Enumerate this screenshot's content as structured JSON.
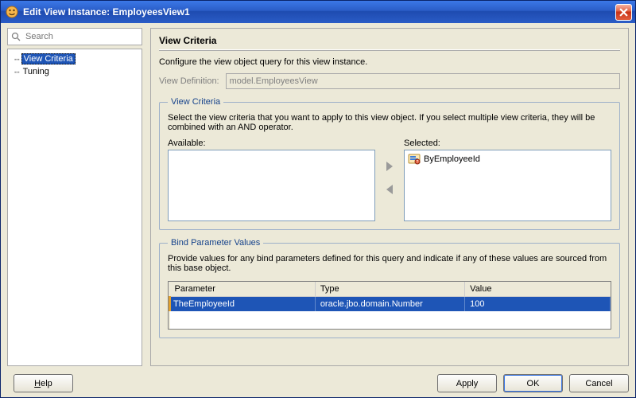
{
  "window": {
    "title_prefix": "Edit View Instance:",
    "instance_name": "EmployeesView1"
  },
  "search": {
    "placeholder": "Search"
  },
  "tree": {
    "items": [
      {
        "label": "View Criteria",
        "selected": true
      },
      {
        "label": "Tuning",
        "selected": false
      }
    ]
  },
  "panel": {
    "heading": "View Criteria",
    "intro": "Configure the view object query for this view instance.",
    "view_definition_label": "View Definition:",
    "view_definition_value": "model.EmployeesView"
  },
  "criteria_group": {
    "legend": "View Criteria",
    "help": "Select the view criteria that you want to apply to this view object. If you select multiple view criteria, they will be combined with an AND operator.",
    "available_label": "Available:",
    "selected_label": "Selected:",
    "available": [],
    "selected": [
      {
        "label": "ByEmployeeId",
        "icon": "criteria-icon"
      }
    ]
  },
  "bindparams_group": {
    "legend": "Bind Parameter Values",
    "help": "Provide values for any bind parameters defined for this query and indicate if any of these values are sourced from this base object.",
    "columns": {
      "param": "Parameter",
      "type": "Type",
      "value": "Value"
    },
    "rows": [
      {
        "param": "TheEmployeeId",
        "type": "oracle.jbo.domain.Number",
        "value": "100",
        "selected": true
      }
    ]
  },
  "buttons": {
    "help": "Help",
    "apply": "Apply",
    "ok": "OK",
    "cancel": "Cancel"
  }
}
